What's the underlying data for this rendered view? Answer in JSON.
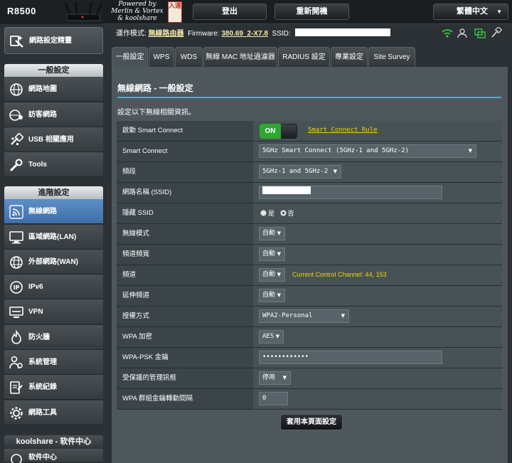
{
  "header": {
    "model": "R8500",
    "powered_line1": "Powered by",
    "powered_line2": "Merlin & Vortex",
    "powered_line3": "& koolshare",
    "seal_text": "入道",
    "logout": "登出",
    "reboot": "重新開機",
    "language": "繁體中文"
  },
  "status": {
    "mode_label": "運作模式:",
    "mode_value": "無線路由器",
    "firmware_label": "Firmware:",
    "firmware_value": "380.69_2-X7.8",
    "ssid_label": "SSID:"
  },
  "sidebar": {
    "quick_setup": "網路設定精靈",
    "general_header": "一般設定",
    "general_items": [
      "網路地圖",
      "訪客網路",
      "USB 相關應用",
      "Tools"
    ],
    "advanced_header": "進階設定",
    "advanced_items": [
      "無線網路",
      "區域網路(LAN)",
      "外部網路(WAN)",
      "IPv6",
      "VPN",
      "防火牆",
      "系統管理",
      "系統紀錄",
      "網路工具"
    ],
    "koolshare_header": "koolshare - 软件中心",
    "koolshare_item": "软件中心"
  },
  "tabs": [
    "一般設定",
    "WPS",
    "WDS",
    "無線 MAC 地址過濾器",
    "RADIUS 設定",
    "專業設定",
    "Site Survey"
  ],
  "panel": {
    "title": "無線網路 - 一般設定",
    "description": "設定以下無線相關資訊。",
    "rows": {
      "smart_connect_enable": {
        "label": "啟動 Smart Connect",
        "toggle": "ON",
        "link": "Smart Connect Rule"
      },
      "smart_connect": {
        "label": "Smart Connect",
        "value": "5GHz Smart Connect (5GHz-1 and 5GHz-2)"
      },
      "band": {
        "label": "頻段",
        "value": "5GHz-1 and 5GHz-2"
      },
      "ssid": {
        "label": "網路名稱 (SSID)"
      },
      "hide_ssid": {
        "label": "隱藏 SSID",
        "yes": "是",
        "no": "否"
      },
      "wireless_mode": {
        "label": "無線模式",
        "value": "自動"
      },
      "bandwidth": {
        "label": "頻道頻寬",
        "value": "自動"
      },
      "channel": {
        "label": "頻道",
        "value": "自動",
        "info": "Current Control Channel: 44, 153"
      },
      "ext_channel": {
        "label": "延伸頻道",
        "value": "自動"
      },
      "auth": {
        "label": "授權方式",
        "value": "WPA2-Personal"
      },
      "wpa_enc": {
        "label": "WPA 加密",
        "value": "AES"
      },
      "psk": {
        "label": "WPA-PSK 金鑰",
        "value": "••••••••••••"
      },
      "pmf": {
        "label": "受保護的管理訊框",
        "value": "停用"
      },
      "rekey": {
        "label": "WPA 群組金鑰轉動間隔",
        "value": "0"
      }
    },
    "apply": "套用本頁面設定"
  },
  "colors": {
    "accent_blue": "#5aa8d6",
    "on_green": "#30a830",
    "link_yellow": "#f2d300",
    "active_menu": "#4a7fbc"
  }
}
